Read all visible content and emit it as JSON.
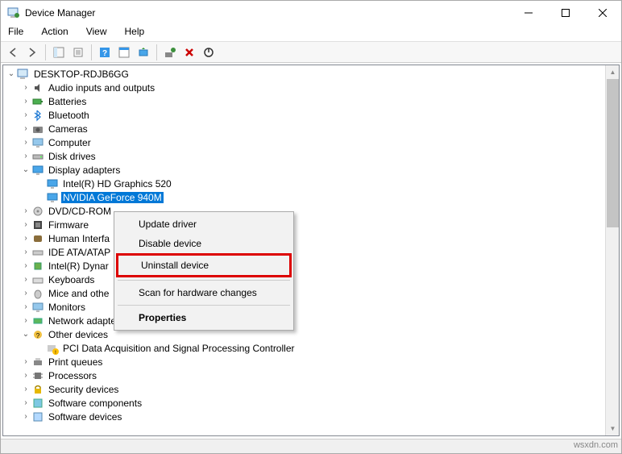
{
  "window": {
    "title": "Device Manager"
  },
  "menu": {
    "file": "File",
    "action": "Action",
    "view": "View",
    "help": "Help"
  },
  "tree": {
    "root": "DESKTOP-RDJB6GG",
    "audio": "Audio inputs and outputs",
    "batteries": "Batteries",
    "bluetooth": "Bluetooth",
    "cameras": "Cameras",
    "computer": "Computer",
    "disk": "Disk drives",
    "display": "Display adapters",
    "display_intel": "Intel(R) HD Graphics 520",
    "display_nvidia": "NVIDIA GeForce 940M",
    "dvd": "DVD/CD-ROM",
    "firmware": "Firmware",
    "hid": "Human Interfa",
    "ide": "IDE ATA/ATAP",
    "intel_dyn": "Intel(R) Dynar",
    "keyboards": "Keyboards",
    "mice": "Mice and othe",
    "monitors": "Monitors",
    "network": "Network adapters",
    "other": "Other devices",
    "pci": "PCI Data Acquisition and Signal Processing Controller",
    "printq": "Print queues",
    "processors": "Processors",
    "security": "Security devices",
    "softcomp": "Software components",
    "softdev": "Software devices"
  },
  "context_menu": {
    "update": "Update driver",
    "disable": "Disable device",
    "uninstall": "Uninstall device",
    "scan": "Scan for hardware changes",
    "properties": "Properties"
  },
  "watermark": "wsxdn.com"
}
